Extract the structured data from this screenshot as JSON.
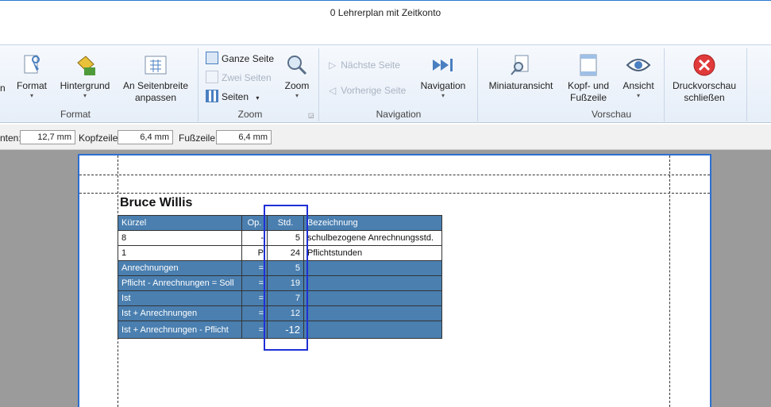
{
  "window": {
    "title": "0 Lehrerplan mit Zeitkonto"
  },
  "ribbon": {
    "partial_left_label": "n",
    "groups": {
      "format": {
        "label": "Format",
        "format_btn": "Format",
        "hintergrund_btn": "Hintergrund",
        "seitenbreite_btn_line1": "An Seitenbreite",
        "seitenbreite_btn_line2": "anpassen"
      },
      "zoom": {
        "label": "Zoom",
        "ganze_seite": "Ganze Seite",
        "zwei_seiten": "Zwei Seiten",
        "seiten": "Seiten",
        "zoom_btn": "Zoom"
      },
      "navigation": {
        "label": "Navigation",
        "naechste_seite": "Nächste Seite",
        "vorherige_seite": "Vorherige Seite",
        "navigation_btn": "Navigation"
      },
      "vorschau": {
        "label": "Vorschau",
        "miniaturansicht": "Miniaturansicht",
        "kopf_line1": "Kopf- und",
        "kopf_line2": "Fußzeile",
        "ansicht": "Ansicht",
        "close_line1": "Druckvorschau",
        "close_line2": "schließen"
      }
    }
  },
  "margins": {
    "unten_label": "nten:",
    "unten_value": "12,7 mm",
    "kopf_label": "Kopfzeile:",
    "kopf_value": "6,4 mm",
    "fuss_label": "Fußzeile:",
    "fuss_value": "6,4 mm"
  },
  "report": {
    "person": "Bruce Willis",
    "headers": [
      "Kürzel",
      "Op.",
      "Std.",
      "Bezeichnung"
    ],
    "rows": [
      [
        "8",
        "-",
        "5",
        "schulbezogene Anrechnungsstd."
      ],
      [
        "1",
        "P",
        "24",
        "Pflichtstunden"
      ]
    ],
    "summary": [
      [
        "Anrechnungen",
        "=",
        "5"
      ],
      [
        "Pflicht - Anrechnungen = Soll",
        "=",
        "19"
      ],
      [
        "Ist",
        "=",
        "7"
      ],
      [
        "Ist + Anrechnungen",
        "=",
        "12"
      ],
      [
        "Ist + Anrechnungen - Pflicht",
        "=",
        "-12"
      ]
    ]
  },
  "colors": {
    "table_blue": "#4a7fb0",
    "highlight": "#1f2fd6",
    "paper_border": "#2c6fd1",
    "close_red": "#e03a3a"
  }
}
